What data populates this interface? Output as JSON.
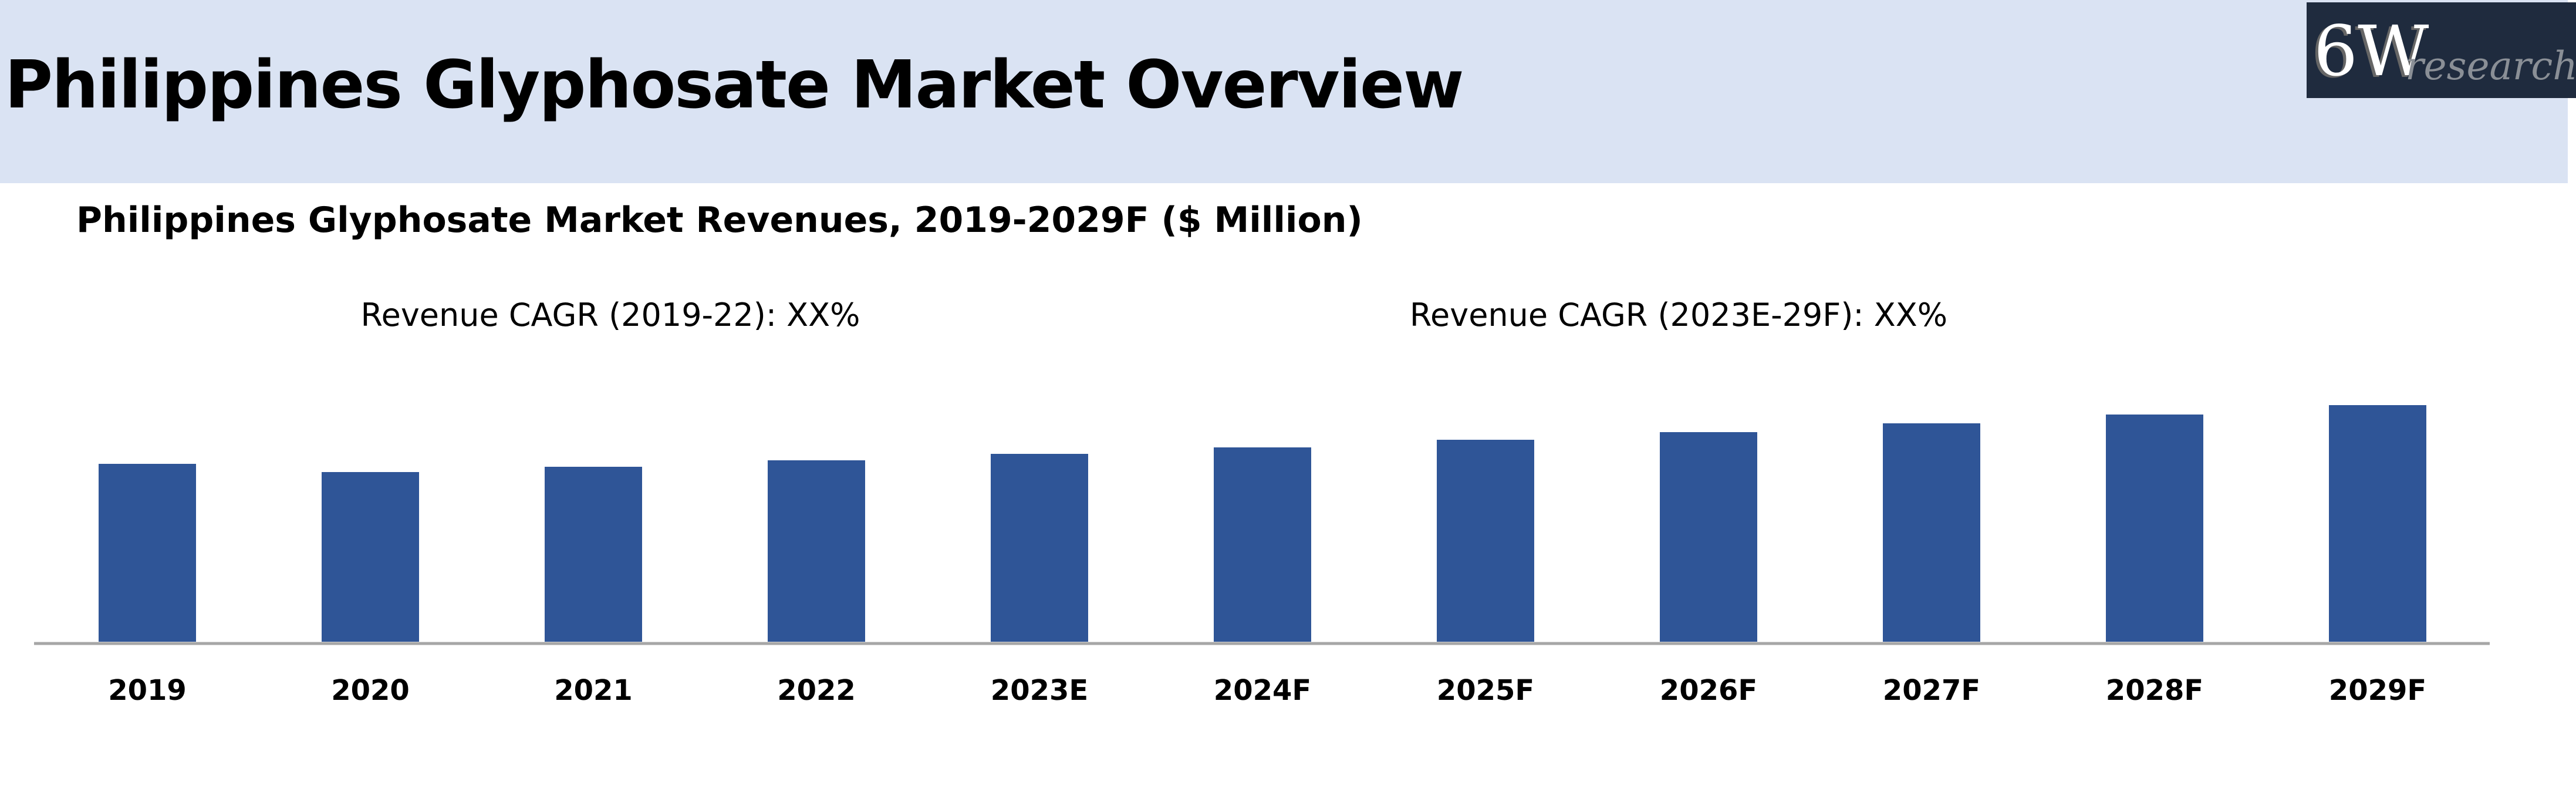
{
  "header": {
    "title": "Philippines Glyphosate Market Overview"
  },
  "logo": {
    "main": "6W",
    "sub": "research"
  },
  "chart_data": {
    "type": "bar",
    "title": "Philippines Glyphosate Market Revenues, 2019-2029F ($ Million)",
    "annotations": [
      "Revenue CAGR (2019-22): XX%",
      "Revenue CAGR (2023E-29F): XX%"
    ],
    "categories": [
      "2019",
      "2020",
      "2021",
      "2022",
      "2023E",
      "2024F",
      "2025F",
      "2026F",
      "2027F",
      "2028F",
      "2029F"
    ],
    "values": [
      303,
      289,
      298,
      309,
      320,
      331,
      344,
      357,
      372,
      387,
      403
    ],
    "value_units": "relative (no axis shown)",
    "xlabel": "",
    "ylabel": "",
    "grid": false,
    "colors": {
      "bar": "#2f5597",
      "axis": "#a6a6a6"
    }
  }
}
